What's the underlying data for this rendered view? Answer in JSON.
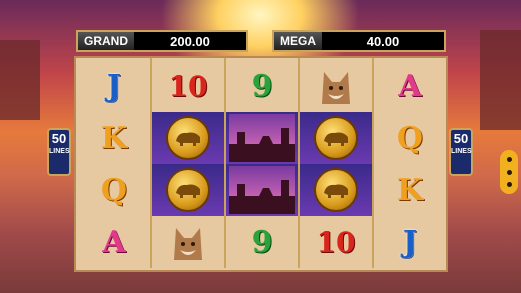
{
  "jackpots": {
    "grand": {
      "label": "GRAND",
      "value": "200.00"
    },
    "mega": {
      "label": "MEGA",
      "value": "40.00"
    }
  },
  "lines": {
    "count": "50",
    "label": "LINES"
  },
  "reels": [
    [
      "J",
      "K",
      "Q",
      "A"
    ],
    [
      "10",
      "buffalo-coin",
      "buffalo-coin",
      "lynx"
    ],
    [
      "9",
      "monument",
      "monument",
      "9"
    ],
    [
      "lynx",
      "buffalo-coin",
      "buffalo-coin",
      "10"
    ],
    [
      "A",
      "Q",
      "K",
      "J"
    ]
  ],
  "colors": {
    "accent": "#c9a45a",
    "menu": "#f0b020"
  }
}
